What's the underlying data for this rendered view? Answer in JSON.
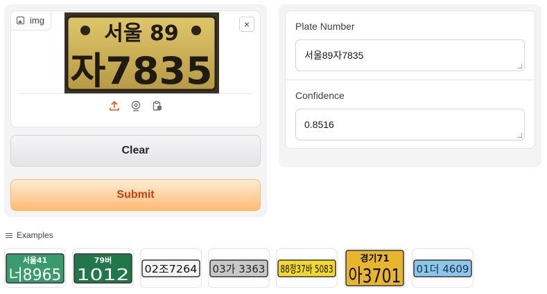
{
  "input_panel": {
    "label": "img",
    "close_glyph": "×",
    "preview": {
      "line1": "서울 89",
      "line2": "자7835"
    },
    "source_icons": [
      "upload-icon",
      "webcam-icon",
      "clipboard-icon"
    ]
  },
  "buttons": {
    "clear": "Clear",
    "submit": "Submit"
  },
  "outputs": {
    "plate_label": "Plate Number",
    "plate_value": "서울89자7835",
    "confidence_label": "Confidence",
    "confidence_value": "0.8516"
  },
  "examples": {
    "heading": "Examples",
    "items": [
      {
        "top": "서울41",
        "main": "너8965",
        "bg": "#3b9a6d",
        "fg": "#ffffff",
        "style": "two-line"
      },
      {
        "top": "79버",
        "main": "1012",
        "bg": "#22774a",
        "fg": "#ffffff",
        "style": "two-line"
      },
      {
        "top": "",
        "main": "02조7264",
        "bg": "#f4f4f4",
        "fg": "#111111",
        "style": "one-line"
      },
      {
        "top": "",
        "main": "03가 3363",
        "bg": "#c8c8c8",
        "fg": "#222222",
        "style": "one-line"
      },
      {
        "top": "",
        "main": "88정37바 5083",
        "bg": "#f3d92b",
        "fg": "#111111",
        "style": "one-line"
      },
      {
        "top": "경기71",
        "main": "아3701",
        "bg": "#e7b62e",
        "fg": "#111111",
        "style": "two-line"
      },
      {
        "top": "",
        "main": "01더 4609",
        "bg": "#8ec6ea",
        "fg": "#12324a",
        "style": "one-line"
      }
    ]
  },
  "colors": {
    "accent": "#ea580c",
    "submit_text": "#c2410c"
  }
}
